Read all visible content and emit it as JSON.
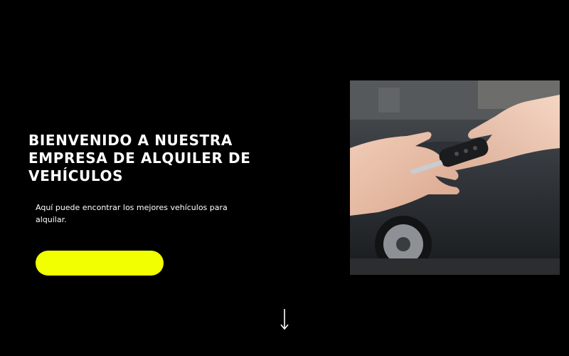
{
  "hero": {
    "title": "BIENVENIDO A NUESTRA EMPRESA DE ALQUILER DE VEHÍCULOS",
    "subtitle": "Aquí puede encontrar los mejores vehículos para alquilar.",
    "cta_label": "",
    "image_icon": "car-key-handover-photo",
    "scroll_icon": "arrow-down-icon"
  },
  "colors": {
    "background": "#000000",
    "text": "#ffffff",
    "accent": "#f2ff00"
  }
}
